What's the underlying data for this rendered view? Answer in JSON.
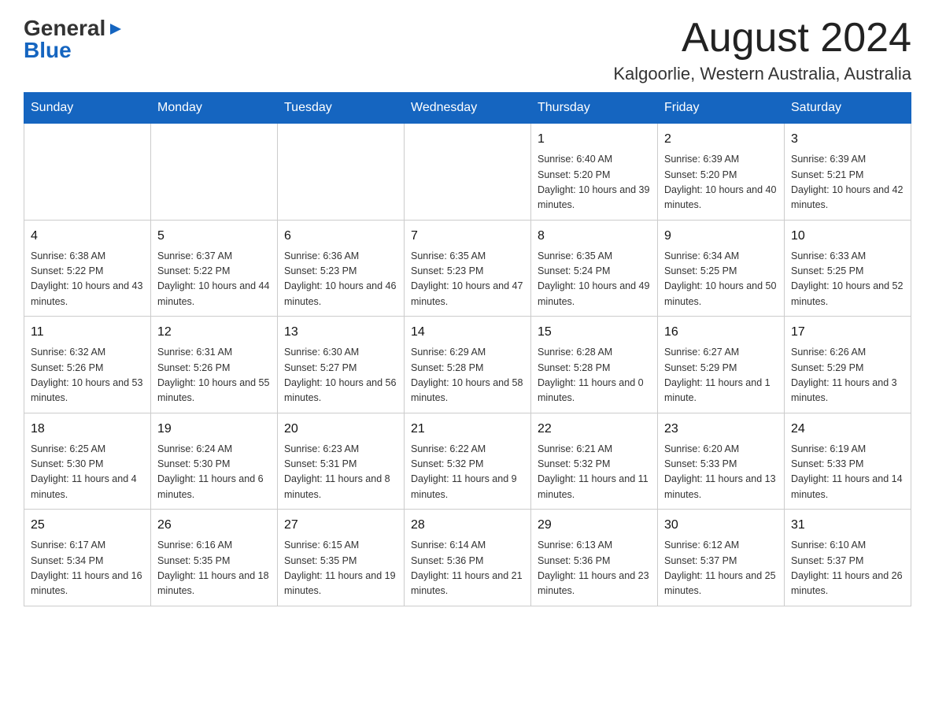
{
  "header": {
    "logo": {
      "general": "General",
      "triangle": "▶",
      "blue": "Blue"
    },
    "month": "August 2024",
    "location": "Kalgoorlie, Western Australia, Australia"
  },
  "weekdays": [
    "Sunday",
    "Monday",
    "Tuesday",
    "Wednesday",
    "Thursday",
    "Friday",
    "Saturday"
  ],
  "weeks": [
    [
      {
        "day": "",
        "info": ""
      },
      {
        "day": "",
        "info": ""
      },
      {
        "day": "",
        "info": ""
      },
      {
        "day": "",
        "info": ""
      },
      {
        "day": "1",
        "info": "Sunrise: 6:40 AM\nSunset: 5:20 PM\nDaylight: 10 hours and 39 minutes."
      },
      {
        "day": "2",
        "info": "Sunrise: 6:39 AM\nSunset: 5:20 PM\nDaylight: 10 hours and 40 minutes."
      },
      {
        "day": "3",
        "info": "Sunrise: 6:39 AM\nSunset: 5:21 PM\nDaylight: 10 hours and 42 minutes."
      }
    ],
    [
      {
        "day": "4",
        "info": "Sunrise: 6:38 AM\nSunset: 5:22 PM\nDaylight: 10 hours and 43 minutes."
      },
      {
        "day": "5",
        "info": "Sunrise: 6:37 AM\nSunset: 5:22 PM\nDaylight: 10 hours and 44 minutes."
      },
      {
        "day": "6",
        "info": "Sunrise: 6:36 AM\nSunset: 5:23 PM\nDaylight: 10 hours and 46 minutes."
      },
      {
        "day": "7",
        "info": "Sunrise: 6:35 AM\nSunset: 5:23 PM\nDaylight: 10 hours and 47 minutes."
      },
      {
        "day": "8",
        "info": "Sunrise: 6:35 AM\nSunset: 5:24 PM\nDaylight: 10 hours and 49 minutes."
      },
      {
        "day": "9",
        "info": "Sunrise: 6:34 AM\nSunset: 5:25 PM\nDaylight: 10 hours and 50 minutes."
      },
      {
        "day": "10",
        "info": "Sunrise: 6:33 AM\nSunset: 5:25 PM\nDaylight: 10 hours and 52 minutes."
      }
    ],
    [
      {
        "day": "11",
        "info": "Sunrise: 6:32 AM\nSunset: 5:26 PM\nDaylight: 10 hours and 53 minutes."
      },
      {
        "day": "12",
        "info": "Sunrise: 6:31 AM\nSunset: 5:26 PM\nDaylight: 10 hours and 55 minutes."
      },
      {
        "day": "13",
        "info": "Sunrise: 6:30 AM\nSunset: 5:27 PM\nDaylight: 10 hours and 56 minutes."
      },
      {
        "day": "14",
        "info": "Sunrise: 6:29 AM\nSunset: 5:28 PM\nDaylight: 10 hours and 58 minutes."
      },
      {
        "day": "15",
        "info": "Sunrise: 6:28 AM\nSunset: 5:28 PM\nDaylight: 11 hours and 0 minutes."
      },
      {
        "day": "16",
        "info": "Sunrise: 6:27 AM\nSunset: 5:29 PM\nDaylight: 11 hours and 1 minute."
      },
      {
        "day": "17",
        "info": "Sunrise: 6:26 AM\nSunset: 5:29 PM\nDaylight: 11 hours and 3 minutes."
      }
    ],
    [
      {
        "day": "18",
        "info": "Sunrise: 6:25 AM\nSunset: 5:30 PM\nDaylight: 11 hours and 4 minutes."
      },
      {
        "day": "19",
        "info": "Sunrise: 6:24 AM\nSunset: 5:30 PM\nDaylight: 11 hours and 6 minutes."
      },
      {
        "day": "20",
        "info": "Sunrise: 6:23 AM\nSunset: 5:31 PM\nDaylight: 11 hours and 8 minutes."
      },
      {
        "day": "21",
        "info": "Sunrise: 6:22 AM\nSunset: 5:32 PM\nDaylight: 11 hours and 9 minutes."
      },
      {
        "day": "22",
        "info": "Sunrise: 6:21 AM\nSunset: 5:32 PM\nDaylight: 11 hours and 11 minutes."
      },
      {
        "day": "23",
        "info": "Sunrise: 6:20 AM\nSunset: 5:33 PM\nDaylight: 11 hours and 13 minutes."
      },
      {
        "day": "24",
        "info": "Sunrise: 6:19 AM\nSunset: 5:33 PM\nDaylight: 11 hours and 14 minutes."
      }
    ],
    [
      {
        "day": "25",
        "info": "Sunrise: 6:17 AM\nSunset: 5:34 PM\nDaylight: 11 hours and 16 minutes."
      },
      {
        "day": "26",
        "info": "Sunrise: 6:16 AM\nSunset: 5:35 PM\nDaylight: 11 hours and 18 minutes."
      },
      {
        "day": "27",
        "info": "Sunrise: 6:15 AM\nSunset: 5:35 PM\nDaylight: 11 hours and 19 minutes."
      },
      {
        "day": "28",
        "info": "Sunrise: 6:14 AM\nSunset: 5:36 PM\nDaylight: 11 hours and 21 minutes."
      },
      {
        "day": "29",
        "info": "Sunrise: 6:13 AM\nSunset: 5:36 PM\nDaylight: 11 hours and 23 minutes."
      },
      {
        "day": "30",
        "info": "Sunrise: 6:12 AM\nSunset: 5:37 PM\nDaylight: 11 hours and 25 minutes."
      },
      {
        "day": "31",
        "info": "Sunrise: 6:10 AM\nSunset: 5:37 PM\nDaylight: 11 hours and 26 minutes."
      }
    ]
  ]
}
